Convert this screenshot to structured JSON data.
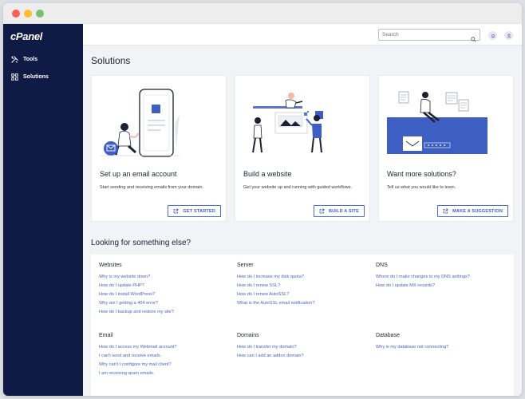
{
  "sidebar": {
    "logo": "cPanel",
    "items": [
      {
        "label": "Tools",
        "icon": "tools-icon"
      },
      {
        "label": "Solutions",
        "icon": "solutions-icon"
      }
    ]
  },
  "header": {
    "search_placeholder": "Search"
  },
  "main": {
    "title": "Solutions",
    "cards": [
      {
        "title": "Set up an email account",
        "description": "Start sending and receiving emails from your domain.",
        "button": "GET STARTED",
        "button_icon": "external-link-icon"
      },
      {
        "title": "Build a website",
        "description": "Get your website up and running with guided workflows.",
        "button": "BUILD A SITE",
        "button_icon": "external-link-icon"
      },
      {
        "title": "Want more solutions?",
        "description": "Tell us what you would like to learn.",
        "button": "MAKE A SUGGESTION",
        "button_icon": "external-link-icon"
      }
    ],
    "help_title": "Looking for something else?",
    "help_sections": [
      {
        "heading": "Websites",
        "links": [
          "Why is my website down?",
          "How do I update PHP?",
          "How do I install WordPress?",
          "Why am I getting a 404 error?",
          "How do I backup and restore my site?"
        ]
      },
      {
        "heading": "Server",
        "links": [
          "How do I increase my disk quota?",
          "How do I renew SSL?",
          "How do I renew AutoSSL?",
          "What is the AutoSSL email notification?"
        ]
      },
      {
        "heading": "DNS",
        "links": [
          "Where do I make changes to my DNS settings?",
          "How do I update MX records?"
        ]
      },
      {
        "heading": "Email",
        "links": [
          "How do I access my Webmail account?",
          "I can't send and receive emails.",
          "Why can't I configure my mail client?",
          "I am receiving spam emails."
        ]
      },
      {
        "heading": "Domains",
        "links": [
          "How do I transfer my domain?",
          "How can I add an addon domain?"
        ]
      },
      {
        "heading": "Database",
        "links": [
          "Why is my database not connecting?"
        ]
      }
    ]
  },
  "colors": {
    "sidebar_bg": "#0f1b44",
    "accent": "#3d5fc4",
    "link": "#4a63c8",
    "page_bg": "#f1f3f7"
  }
}
